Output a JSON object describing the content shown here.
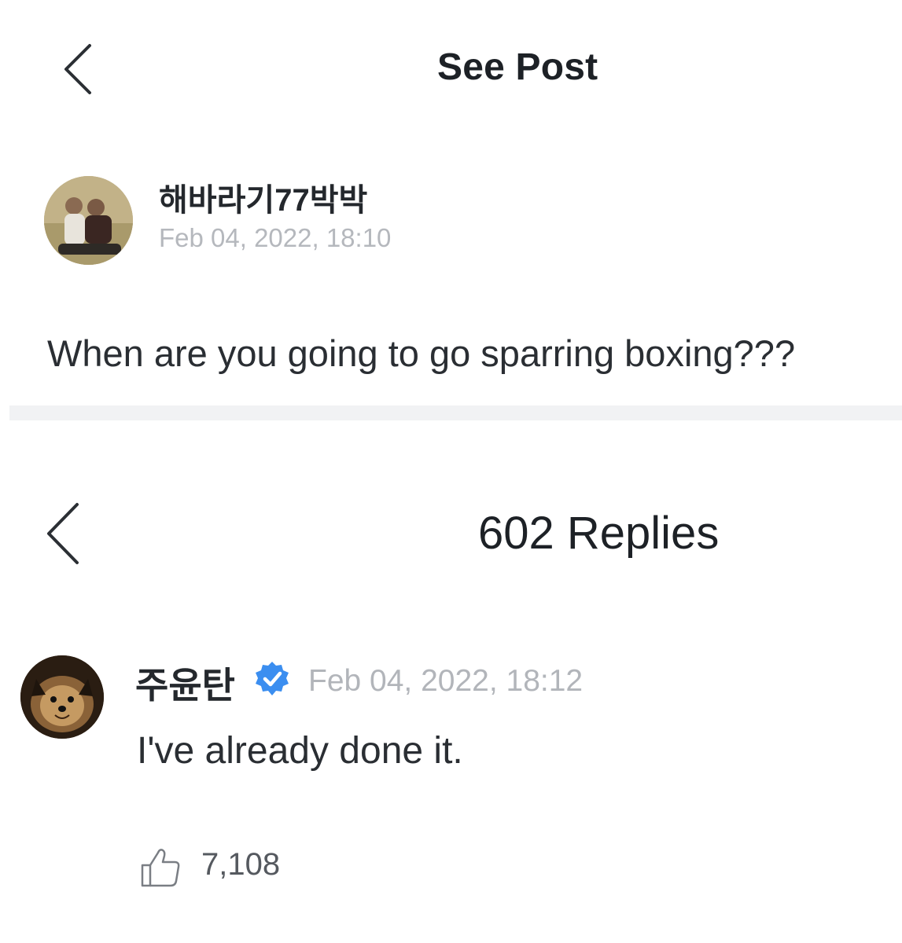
{
  "header": {
    "title": "See Post",
    "back_icon": "chevron-left-icon"
  },
  "post": {
    "avatar_icon": "user-avatar",
    "username": "해바라기77박박",
    "timestamp": "Feb 04, 2022, 18:10",
    "body": "When are you going to go sparring boxing???"
  },
  "replies_header": {
    "title": "602 Replies",
    "back_icon": "chevron-left-icon"
  },
  "reply": {
    "avatar_icon": "dog-avatar",
    "username": "주윤탄",
    "verified_icon": "verified-badge-icon",
    "timestamp": "Feb 04, 2022, 18:12",
    "body": "I've already done it.",
    "like_icon": "thumbs-up-icon",
    "like_count": "7,108"
  },
  "colors": {
    "verified_blue": "#3b8ef0",
    "divider": "#f1f2f4",
    "muted_text": "#b5b8bd"
  }
}
